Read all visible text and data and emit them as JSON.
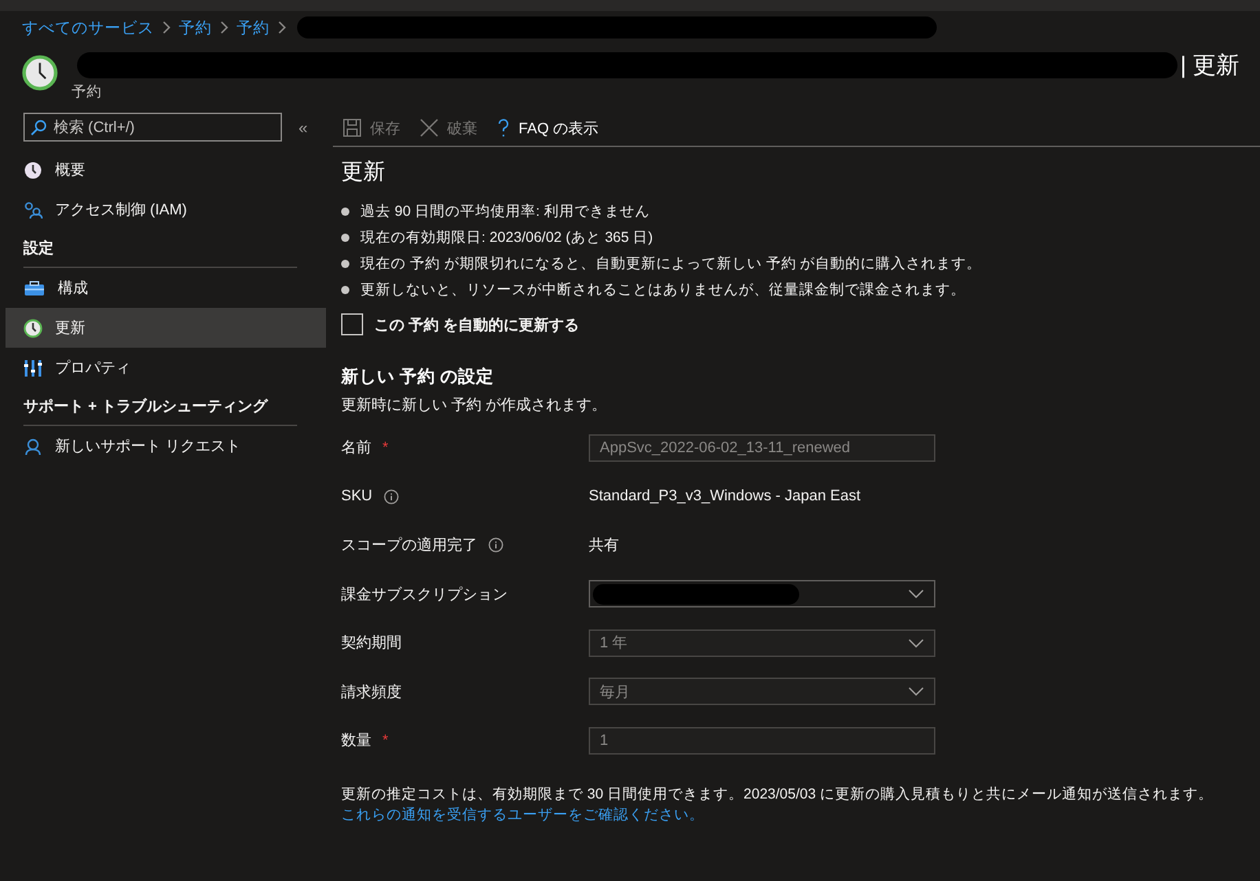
{
  "breadcrumb": {
    "items": [
      {
        "label": "すべてのサービス"
      },
      {
        "label": "予約"
      },
      {
        "label": "予約"
      }
    ],
    "redacted_tail": true
  },
  "header": {
    "title": "| 更新",
    "subtitle": "予約",
    "redacted_title": true
  },
  "sidebar": {
    "search": {
      "placeholder": "検索 (Ctrl+/)"
    },
    "collapse": "«",
    "items": [
      {
        "kind": "item",
        "label": "概要",
        "selected": false
      },
      {
        "kind": "item",
        "label": "アクセス制御 (IAM)",
        "selected": false
      },
      {
        "kind": "section",
        "label": "設定"
      },
      {
        "kind": "item",
        "label": "構成",
        "selected": false
      },
      {
        "kind": "item",
        "label": "更新",
        "selected": true
      },
      {
        "kind": "item",
        "label": "プロパティ",
        "selected": false
      },
      {
        "kind": "section",
        "label": "サポート + トラブルシューティング"
      },
      {
        "kind": "item",
        "label": "新しいサポート リクエスト",
        "selected": false
      }
    ]
  },
  "toolbar": [
    {
      "label": "保存",
      "disabled": true
    },
    {
      "label": "破棄",
      "disabled": true
    },
    {
      "label": "FAQ の表示",
      "disabled": false
    }
  ],
  "content": {
    "heading": "更新",
    "bullets": [
      "過去 90 日間の平均使用率: 利用できません",
      "現在の有効期限日: 2023/06/02 (あと 365 日)",
      "現在の 予約 が期限切れになると、自動更新によって新しい 予約 が自動的に購入されます。",
      "更新しないと、リソースが中断されることはありませんが、従量課金制で課金されます。"
    ],
    "auto_renew": {
      "label": "この 予約 を自動的に更新する",
      "checked": false
    },
    "settings_title": "新しい 予約 の設定",
    "settings_subtitle": "更新時に新しい 予約 が作成されます。",
    "fields": [
      {
        "kind": "input",
        "label": "名前",
        "required_mark": "*",
        "value": "AppSvc_2022-06-02_13-11_renewed",
        "disabled": true
      },
      {
        "kind": "text",
        "label": "SKU",
        "info": true,
        "value": "Standard_P3_v3_Windows - Japan East"
      },
      {
        "kind": "text",
        "label": "スコープの適用完了",
        "info": true,
        "value": "共有"
      },
      {
        "kind": "select",
        "label": "課金サブスクリプション",
        "redacted": true,
        "disabled": false
      },
      {
        "kind": "select",
        "label": "契約期間",
        "value": "1 年",
        "disabled": true
      },
      {
        "kind": "select",
        "label": "請求頻度",
        "value": "毎月",
        "disabled": true
      },
      {
        "kind": "input",
        "label": "数量",
        "required_mark": "*",
        "value": "1",
        "disabled": true
      }
    ],
    "note": {
      "text": "更新の推定コストは、有効期限まで 30 日間使用できます。2023/05/03 に更新の購入見積もりと共にメール通知が送信されます。",
      "link": "これらの通知を受信するユーザーをご確認ください。"
    }
  }
}
